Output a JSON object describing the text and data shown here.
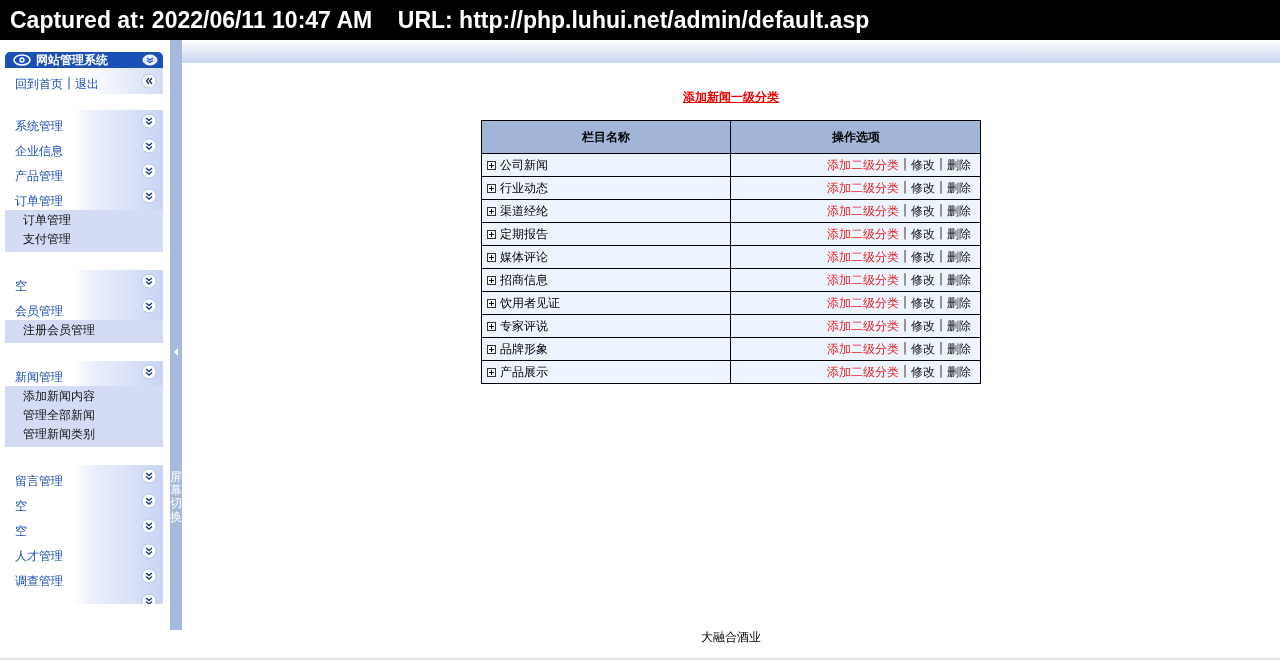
{
  "capture_bar": {
    "text": "Captured at: 2022/06/11 10:47 AM    URL: http://php.luhui.net/admin/default.asp"
  },
  "sidebar": {
    "title": "网站管理系统",
    "home_link": "回到首页",
    "separator": "|",
    "logout_link": "退出",
    "sections": [
      {
        "items": [
          {
            "label": "系统管理"
          },
          {
            "label": "企业信息"
          },
          {
            "label": "产品管理"
          },
          {
            "label": "订单管理",
            "children": [
              "订单管理",
              "支付管理"
            ]
          }
        ]
      },
      {
        "items": [
          {
            "label": "空"
          },
          {
            "label": "会员管理",
            "children": [
              "注册会员管理"
            ]
          }
        ]
      },
      {
        "items": [
          {
            "label": "新闻管理",
            "children": [
              "添加新闻内容",
              "管理全部新闻",
              "管理新闻类别"
            ]
          }
        ]
      },
      {
        "items": [
          {
            "label": "留言管理"
          },
          {
            "label": "空"
          },
          {
            "label": "空"
          },
          {
            "label": "人才管理"
          },
          {
            "label": "调查管理"
          }
        ]
      }
    ],
    "toggle_label": "屏幕切换"
  },
  "main": {
    "add_link": "添加新闻一级分类",
    "table": {
      "columns": [
        "栏目名称",
        "操作选项"
      ],
      "rows": [
        {
          "name": "公司新闻",
          "actions": [
            {
              "kind": "add",
              "label": "添加二级分类"
            },
            {
              "kind": "edit",
              "label": "修改"
            },
            {
              "kind": "delete",
              "label": "删除"
            }
          ]
        },
        {
          "name": "行业动态",
          "actions": [
            {
              "kind": "add",
              "label": "添加二级分类"
            },
            {
              "kind": "edit",
              "label": "修改"
            },
            {
              "kind": "delete",
              "label": "删除"
            }
          ]
        },
        {
          "name": "渠道经纶",
          "actions": [
            {
              "kind": "add",
              "label": "添加二级分类"
            },
            {
              "kind": "edit",
              "label": "修改"
            },
            {
              "kind": "delete",
              "label": "删除"
            }
          ]
        },
        {
          "name": "定期报告",
          "actions": [
            {
              "kind": "add",
              "label": "添加二级分类"
            },
            {
              "kind": "edit",
              "label": "修改"
            },
            {
              "kind": "delete",
              "label": "删除"
            }
          ]
        },
        {
          "name": "媒体评论",
          "actions": [
            {
              "kind": "add",
              "label": "添加二级分类"
            },
            {
              "kind": "edit",
              "label": "修改"
            },
            {
              "kind": "delete",
              "label": "删除"
            }
          ]
        },
        {
          "name": "招商信息",
          "actions": [
            {
              "kind": "add",
              "label": "添加二级分类"
            },
            {
              "kind": "edit",
              "label": "修改"
            },
            {
              "kind": "delete",
              "label": "删除"
            }
          ]
        },
        {
          "name": "饮用者见证",
          "actions": [
            {
              "kind": "add",
              "label": "添加二级分类"
            },
            {
              "kind": "edit",
              "label": "修改"
            },
            {
              "kind": "delete",
              "label": "删除"
            }
          ]
        },
        {
          "name": "专家评说",
          "actions": [
            {
              "kind": "add",
              "label": "添加二级分类"
            },
            {
              "kind": "edit",
              "label": "修改"
            },
            {
              "kind": "delete",
              "label": "删除"
            }
          ]
        },
        {
          "name": "品牌形象",
          "actions": [
            {
              "kind": "add",
              "label": "添加二级分类"
            },
            {
              "kind": "edit",
              "label": "修改"
            },
            {
              "kind": "delete",
              "label": "删除"
            }
          ]
        },
        {
          "name": "产品展示",
          "actions": [
            {
              "kind": "add",
              "label": "添加二级分类"
            },
            {
              "kind": "edit",
              "label": "修改"
            },
            {
              "kind": "delete",
              "label": "删除"
            }
          ]
        }
      ],
      "action_separator": "|"
    },
    "footer": "大融合酒业"
  }
}
